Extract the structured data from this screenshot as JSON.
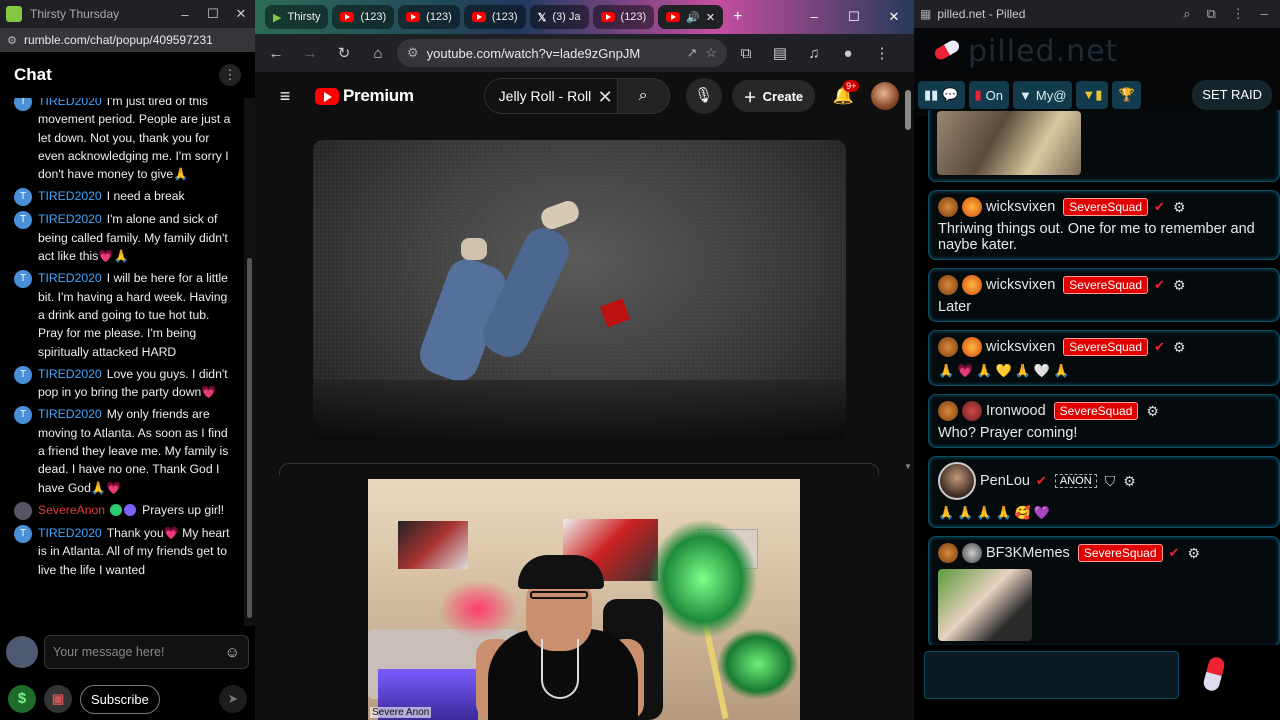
{
  "rumble": {
    "window_title": "Thirsty Thursday",
    "url": "rumble.com/chat/popup/409597231",
    "header_title": "Chat",
    "messages": [
      {
        "user": "TIRED2020",
        "avatar": "T",
        "text": "I'm just tired of this movement period. People are just a let down. Not you, thank you for even acknowledging me. I'm sorry I don't have money to give🙏"
      },
      {
        "user": "TIRED2020",
        "avatar": "T",
        "text": "I need a break"
      },
      {
        "user": "TIRED2020",
        "avatar": "T",
        "text": "I'm alone and sick of being called family. My family didn't act like this💗🙏"
      },
      {
        "user": "TIRED2020",
        "avatar": "T",
        "text": "I will be here for a little bit. I'm having a hard week. Having a drink and going to tue hot tub. Pray for me please. I'm being spiritually attacked HARD"
      },
      {
        "user": "TIRED2020",
        "avatar": "T",
        "text": "Love you guys. I didn't pop in yo bring the party down💗"
      },
      {
        "user": "TIRED2020",
        "avatar": "T",
        "text": "My only friends are moving to Atlanta. As soon as I find a friend they leave me. My family is dead. I have no one. Thank God I have God🙏💗"
      },
      {
        "user": "SevereAnon",
        "avatar": "",
        "text": "Prayers up girl!",
        "color": "#e53935"
      },
      {
        "user": "TIRED2020",
        "avatar": "T",
        "text": "Thank you💗 My heart is in Atlanta. All of my friends get to live the life I wanted"
      }
    ],
    "input_placeholder": "Your message here!",
    "subscribe_label": "Subscribe",
    "dollar_icon": "$"
  },
  "chrome": {
    "tabs": [
      {
        "label": "Thirsty",
        "icon": "rumble-icon"
      },
      {
        "label": "(123)",
        "icon": "youtube-icon"
      },
      {
        "label": "(123)",
        "icon": "youtube-icon"
      },
      {
        "label": "(123)",
        "icon": "youtube-icon"
      },
      {
        "label": "(3) Ja",
        "icon": "x-icon"
      },
      {
        "label": "(123)",
        "icon": "youtube-icon"
      },
      {
        "label": "",
        "icon": "youtube-icon"
      }
    ],
    "url": "youtube.com/watch?v=lade9zGnpJM"
  },
  "youtube": {
    "logo_text": "Premium",
    "search_value": "Jelly Roll - Roll M",
    "create_label": "Create",
    "notif_count": "9+"
  },
  "stream": {
    "cam_label": "Severe Anon"
  },
  "pilled": {
    "window_title": "pilled.net - Pilled",
    "logo_text": "pilled.net",
    "toolbar": {
      "on_label": "On",
      "my_label": "My@",
      "raid_label": "SET RAID"
    },
    "posts": [
      {
        "user": "wicksvixen",
        "squad": "SevereSquad",
        "text": "Thriwing things out. One for me to remember and naybe kater.",
        "emoji": ""
      },
      {
        "user": "wicksvixen",
        "squad": "SevereSquad",
        "text": "Later",
        "emoji": ""
      },
      {
        "user": "wicksvixen",
        "squad": "SevereSquad",
        "text": "",
        "emoji": "🙏💗🙏💛🙏🤍🙏"
      },
      {
        "user": "Ironwood",
        "squad": "SevereSquad",
        "text": "Who? Prayer coming!",
        "emoji": ""
      },
      {
        "user": "PenLou",
        "squad": "",
        "badge": "ANON",
        "text": "",
        "emoji": "🙏🙏🙏🙏🥰💜"
      },
      {
        "user": "BF3KMemes",
        "squad": "SevereSquad",
        "text": "",
        "emoji": ""
      }
    ]
  }
}
